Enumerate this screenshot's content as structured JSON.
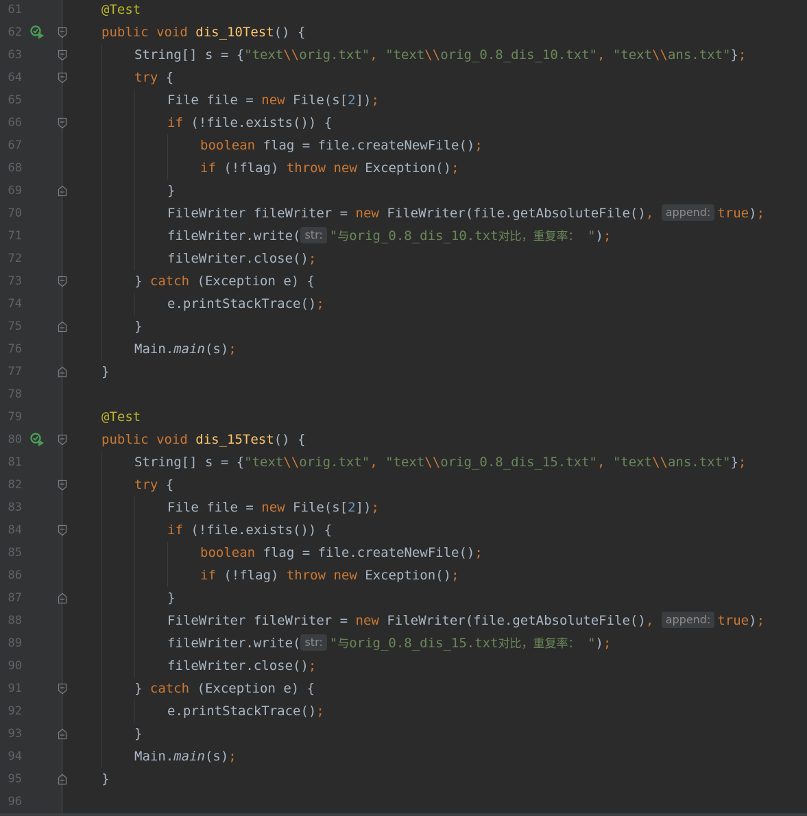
{
  "editor": {
    "lines": [
      {
        "n": "61",
        "fold": "",
        "run": false,
        "indent": 0,
        "tokens": [
          [
            "ann",
            "@Test"
          ]
        ]
      },
      {
        "n": "62",
        "fold": "open",
        "run": true,
        "indent": 0,
        "tokens": [
          [
            "kw",
            "public "
          ],
          [
            "kw",
            "void "
          ],
          [
            "fn",
            "dis_10Test"
          ],
          [
            "",
            "() {"
          ]
        ]
      },
      {
        "n": "63",
        "fold": "open",
        "run": false,
        "indent": 1,
        "tokens": [
          [
            "",
            "String[] s = {"
          ],
          [
            "str",
            "\"text"
          ],
          [
            "esc",
            "\\\\"
          ],
          [
            "str",
            "orig.txt\""
          ],
          [
            "kw",
            ", "
          ],
          [
            "str",
            "\"text"
          ],
          [
            "esc",
            "\\\\"
          ],
          [
            "str",
            "orig_0.8_dis_10.txt\""
          ],
          [
            "kw",
            ", "
          ],
          [
            "str",
            "\"text"
          ],
          [
            "esc",
            "\\\\"
          ],
          [
            "str",
            "ans.txt\""
          ],
          [
            "",
            "}"
          ],
          [
            "kw",
            ";"
          ]
        ]
      },
      {
        "n": "64",
        "fold": "open",
        "run": false,
        "indent": 1,
        "tokens": [
          [
            "kw",
            "try "
          ],
          [
            "",
            "{"
          ]
        ]
      },
      {
        "n": "65",
        "fold": "",
        "run": false,
        "indent": 2,
        "tokens": [
          [
            "",
            "File file = "
          ],
          [
            "kw",
            "new "
          ],
          [
            "",
            "File(s["
          ],
          [
            "num",
            "2"
          ],
          [
            "",
            "])"
          ],
          [
            "kw",
            ";"
          ]
        ]
      },
      {
        "n": "66",
        "fold": "open",
        "run": false,
        "indent": 2,
        "tokens": [
          [
            "kw",
            "if "
          ],
          [
            "",
            "(!file.exists()) {"
          ]
        ]
      },
      {
        "n": "67",
        "fold": "",
        "run": false,
        "indent": 3,
        "tokens": [
          [
            "kw",
            "boolean "
          ],
          [
            "",
            "flag = file.createNewFile()"
          ],
          [
            "kw",
            ";"
          ]
        ]
      },
      {
        "n": "68",
        "fold": "",
        "run": false,
        "indent": 3,
        "tokens": [
          [
            "kw",
            "if "
          ],
          [
            "",
            "(!flag) "
          ],
          [
            "kw",
            "throw new "
          ],
          [
            "",
            "Exception()"
          ],
          [
            "kw",
            ";"
          ]
        ]
      },
      {
        "n": "69",
        "fold": "close",
        "run": false,
        "indent": 2,
        "tokens": [
          [
            "",
            "}"
          ]
        ]
      },
      {
        "n": "70",
        "fold": "",
        "run": false,
        "indent": 2,
        "tokens": [
          [
            "",
            "FileWriter fileWriter = "
          ],
          [
            "kw",
            "new "
          ],
          [
            "",
            "FileWriter(file.getAbsoluteFile()"
          ],
          [
            "kw",
            ", "
          ],
          [
            "hint",
            "append:"
          ],
          [
            "kw",
            "true"
          ],
          [
            "",
            ")"
          ],
          [
            "kw",
            ";"
          ]
        ]
      },
      {
        "n": "71",
        "fold": "",
        "run": false,
        "indent": 2,
        "tokens": [
          [
            "",
            "fileWriter.write("
          ],
          [
            "hint",
            "str:"
          ],
          [
            "str",
            "\""
          ],
          [
            "strcjk",
            "与"
          ],
          [
            "str",
            "orig_0.8_dis_10.txt"
          ],
          [
            "strcjk",
            "对比，重复率："
          ],
          [
            "str",
            " \""
          ],
          [
            "",
            ")"
          ],
          [
            "kw",
            ";"
          ]
        ]
      },
      {
        "n": "72",
        "fold": "",
        "run": false,
        "indent": 2,
        "tokens": [
          [
            "",
            "fileWriter.close()"
          ],
          [
            "kw",
            ";"
          ]
        ]
      },
      {
        "n": "73",
        "fold": "open",
        "run": false,
        "indent": 1,
        "tokens": [
          [
            "",
            "} "
          ],
          [
            "kw",
            "catch "
          ],
          [
            "",
            "(Exception e) {"
          ]
        ]
      },
      {
        "n": "74",
        "fold": "",
        "run": false,
        "indent": 2,
        "tokens": [
          [
            "",
            "e.printStackTrace()"
          ],
          [
            "kw",
            ";"
          ]
        ]
      },
      {
        "n": "75",
        "fold": "close",
        "run": false,
        "indent": 1,
        "tokens": [
          [
            "",
            "}"
          ]
        ]
      },
      {
        "n": "76",
        "fold": "",
        "run": false,
        "indent": 1,
        "tokens": [
          [
            "",
            "Main."
          ],
          [
            "ital",
            "main"
          ],
          [
            "",
            "(s)"
          ],
          [
            "kw",
            ";"
          ]
        ]
      },
      {
        "n": "77",
        "fold": "close",
        "run": false,
        "indent": 0,
        "tokens": [
          [
            "",
            "}"
          ]
        ]
      },
      {
        "n": "78",
        "fold": "",
        "run": false,
        "indent": 0,
        "tokens": []
      },
      {
        "n": "79",
        "fold": "",
        "run": false,
        "indent": 0,
        "tokens": [
          [
            "ann",
            "@Test"
          ]
        ]
      },
      {
        "n": "80",
        "fold": "open",
        "run": true,
        "indent": 0,
        "tokens": [
          [
            "kw",
            "public "
          ],
          [
            "kw",
            "void "
          ],
          [
            "fn",
            "dis_15Test"
          ],
          [
            "",
            "() {"
          ]
        ]
      },
      {
        "n": "81",
        "fold": "",
        "run": false,
        "indent": 1,
        "tokens": [
          [
            "",
            "String[] s = {"
          ],
          [
            "str",
            "\"text"
          ],
          [
            "esc",
            "\\\\"
          ],
          [
            "str",
            "orig.txt\""
          ],
          [
            "kw",
            ", "
          ],
          [
            "str",
            "\"text"
          ],
          [
            "esc",
            "\\\\"
          ],
          [
            "str",
            "orig_0.8_dis_15.txt\""
          ],
          [
            "kw",
            ", "
          ],
          [
            "str",
            "\"text"
          ],
          [
            "esc",
            "\\\\"
          ],
          [
            "str",
            "ans.txt\""
          ],
          [
            "",
            "}"
          ],
          [
            "kw",
            ";"
          ]
        ]
      },
      {
        "n": "82",
        "fold": "open",
        "run": false,
        "indent": 1,
        "tokens": [
          [
            "kw",
            "try "
          ],
          [
            "",
            "{"
          ]
        ]
      },
      {
        "n": "83",
        "fold": "",
        "run": false,
        "indent": 2,
        "tokens": [
          [
            "",
            "File file = "
          ],
          [
            "kw",
            "new "
          ],
          [
            "",
            "File(s["
          ],
          [
            "num",
            "2"
          ],
          [
            "",
            "])"
          ],
          [
            "kw",
            ";"
          ]
        ]
      },
      {
        "n": "84",
        "fold": "open",
        "run": false,
        "indent": 2,
        "tokens": [
          [
            "kw",
            "if "
          ],
          [
            "",
            "(!file.exists()) {"
          ]
        ]
      },
      {
        "n": "85",
        "fold": "",
        "run": false,
        "indent": 3,
        "tokens": [
          [
            "kw",
            "boolean "
          ],
          [
            "",
            "flag = file.createNewFile()"
          ],
          [
            "kw",
            ";"
          ]
        ]
      },
      {
        "n": "86",
        "fold": "",
        "run": false,
        "indent": 3,
        "tokens": [
          [
            "kw",
            "if "
          ],
          [
            "",
            "(!flag) "
          ],
          [
            "kw",
            "throw new "
          ],
          [
            "",
            "Exception()"
          ],
          [
            "kw",
            ";"
          ]
        ]
      },
      {
        "n": "87",
        "fold": "close",
        "run": false,
        "indent": 2,
        "tokens": [
          [
            "",
            "}"
          ]
        ]
      },
      {
        "n": "88",
        "fold": "",
        "run": false,
        "indent": 2,
        "tokens": [
          [
            "",
            "FileWriter fileWriter = "
          ],
          [
            "kw",
            "new "
          ],
          [
            "",
            "FileWriter(file.getAbsoluteFile()"
          ],
          [
            "kw",
            ", "
          ],
          [
            "hint",
            "append:"
          ],
          [
            "kw",
            "true"
          ],
          [
            "",
            ")"
          ],
          [
            "kw",
            ";"
          ]
        ]
      },
      {
        "n": "89",
        "fold": "",
        "run": false,
        "indent": 2,
        "tokens": [
          [
            "",
            "fileWriter.write("
          ],
          [
            "hint",
            "str:"
          ],
          [
            "str",
            "\""
          ],
          [
            "strcjk",
            "与"
          ],
          [
            "str",
            "orig_0.8_dis_15.txt"
          ],
          [
            "strcjk",
            "对比，重复率："
          ],
          [
            "str",
            " \""
          ],
          [
            "",
            ")"
          ],
          [
            "kw",
            ";"
          ]
        ]
      },
      {
        "n": "90",
        "fold": "",
        "run": false,
        "indent": 2,
        "tokens": [
          [
            "",
            "fileWriter.close()"
          ],
          [
            "kw",
            ";"
          ]
        ]
      },
      {
        "n": "91",
        "fold": "open",
        "run": false,
        "indent": 1,
        "tokens": [
          [
            "",
            "} "
          ],
          [
            "kw",
            "catch "
          ],
          [
            "",
            "(Exception e) {"
          ]
        ]
      },
      {
        "n": "92",
        "fold": "",
        "run": false,
        "indent": 2,
        "tokens": [
          [
            "",
            "e.printStackTrace()"
          ],
          [
            "kw",
            ";"
          ]
        ]
      },
      {
        "n": "93",
        "fold": "close",
        "run": false,
        "indent": 1,
        "tokens": [
          [
            "",
            "}"
          ]
        ]
      },
      {
        "n": "94",
        "fold": "",
        "run": false,
        "indent": 1,
        "tokens": [
          [
            "",
            "Main."
          ],
          [
            "ital",
            "main"
          ],
          [
            "",
            "(s)"
          ],
          [
            "kw",
            ";"
          ]
        ]
      },
      {
        "n": "95",
        "fold": "close",
        "run": false,
        "indent": 0,
        "tokens": [
          [
            "",
            "}"
          ]
        ]
      },
      {
        "n": "96",
        "fold": "",
        "run": false,
        "indent": 0,
        "tokens": []
      }
    ]
  },
  "colors": {
    "background": "#2b2b2b",
    "gutter": "#313335",
    "keyword": "#cc7832",
    "annotation": "#bbb529",
    "method": "#ffc66d",
    "string": "#6a8759",
    "number": "#6897bb",
    "default": "#a9b7c6",
    "run_icon": "#499c54"
  },
  "icons": {
    "run": "run-test-icon",
    "fold_open": "fold-open-icon",
    "fold_close": "fold-close-icon"
  }
}
